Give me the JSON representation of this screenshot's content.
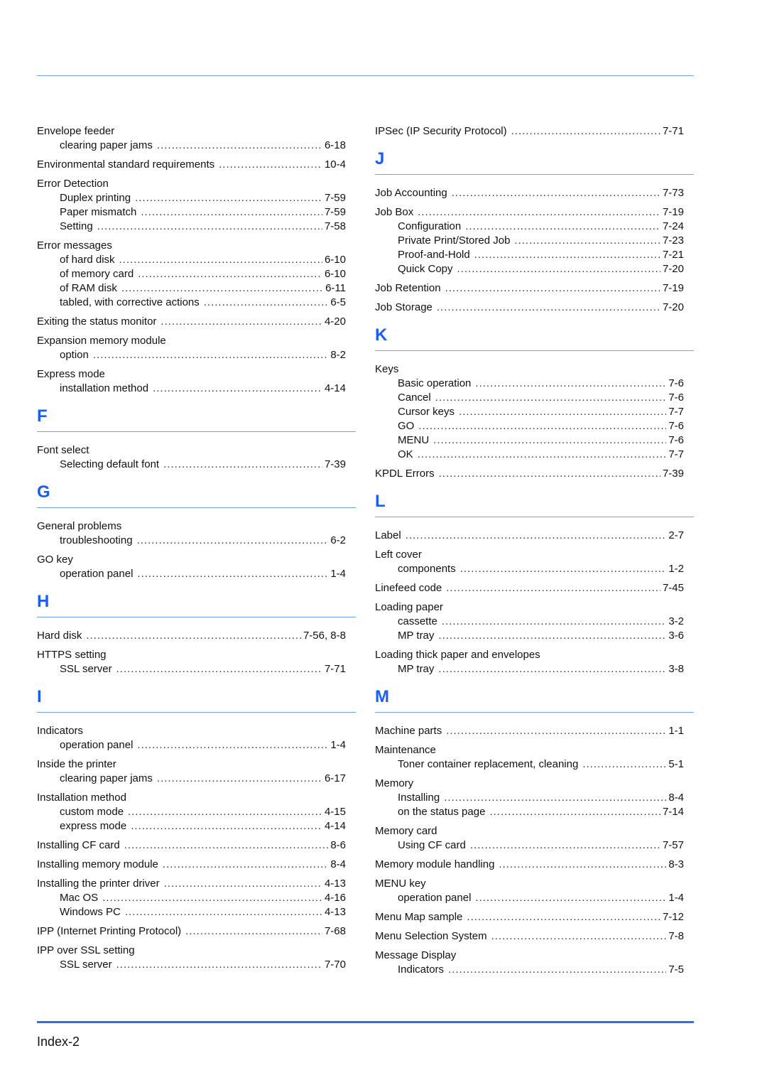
{
  "footer": {
    "page_label": "Index-2"
  },
  "left_column": [
    {
      "type": "entry",
      "term": "Envelope feeder",
      "subs": [
        {
          "term": "clearing paper jams",
          "page": "6-18"
        }
      ]
    },
    {
      "type": "entry",
      "term": "Environmental standard requirements",
      "page": "10-4"
    },
    {
      "type": "entry",
      "term": "Error Detection",
      "subs": [
        {
          "term": "Duplex printing",
          "page": "7-59"
        },
        {
          "term": "Paper mismatch",
          "page": "7-59"
        },
        {
          "term": "Setting",
          "page": "7-58"
        }
      ]
    },
    {
      "type": "entry",
      "term": "Error messages",
      "subs": [
        {
          "term": "of hard disk",
          "page": "6-10"
        },
        {
          "term": "of memory card",
          "page": "6-10"
        },
        {
          "term": "of RAM disk",
          "page": "6-11"
        },
        {
          "term": "tabled, with corrective actions",
          "page": "6-5"
        }
      ]
    },
    {
      "type": "entry",
      "term": "Exiting the status monitor",
      "page": "4-20"
    },
    {
      "type": "entry",
      "term": "Expansion memory module",
      "subs": [
        {
          "term": "option",
          "page": "8-2"
        }
      ]
    },
    {
      "type": "entry",
      "term": "Express mode",
      "subs": [
        {
          "term": "installation method",
          "page": "4-14"
        }
      ]
    },
    {
      "type": "letter",
      "letter": "F"
    },
    {
      "type": "entry",
      "term": "Font select",
      "subs": [
        {
          "term": "Selecting default font",
          "page": "7-39"
        }
      ]
    },
    {
      "type": "letter",
      "letter": "G"
    },
    {
      "type": "entry",
      "term": "General problems",
      "subs": [
        {
          "term": "troubleshooting",
          "page": "6-2"
        }
      ]
    },
    {
      "type": "entry",
      "term": "GO key",
      "subs": [
        {
          "term": "operation panel",
          "page": "1-4"
        }
      ]
    },
    {
      "type": "letter",
      "letter": "H"
    },
    {
      "type": "entry",
      "term": "Hard disk",
      "page": "7-56, 8-8"
    },
    {
      "type": "entry",
      "term": "HTTPS setting",
      "subs": [
        {
          "term": "SSL server",
          "page": "7-71"
        }
      ]
    },
    {
      "type": "letter",
      "letter": "I"
    },
    {
      "type": "entry",
      "term": "Indicators",
      "subs": [
        {
          "term": "operation panel",
          "page": "1-4"
        }
      ]
    },
    {
      "type": "entry",
      "term": "Inside the printer",
      "subs": [
        {
          "term": "clearing paper jams",
          "page": "6-17"
        }
      ]
    },
    {
      "type": "entry",
      "term": "Installation method",
      "subs": [
        {
          "term": "custom mode",
          "page": "4-15"
        },
        {
          "term": "express mode",
          "page": "4-14"
        }
      ]
    },
    {
      "type": "entry",
      "term": "Installing CF card",
      "page": "8-6"
    },
    {
      "type": "entry",
      "term": "Installing memory module",
      "page": "8-4"
    },
    {
      "type": "entry",
      "term": "Installing the printer driver",
      "page": "4-13",
      "subs": [
        {
          "term": "Mac OS",
          "page": "4-16"
        },
        {
          "term": "Windows PC",
          "page": "4-13"
        }
      ]
    },
    {
      "type": "entry",
      "term": "IPP (Internet Printing Protocol)",
      "page": "7-68"
    },
    {
      "type": "entry",
      "term": "IPP over SSL setting",
      "subs": [
        {
          "term": "SSL server",
          "page": "7-70"
        }
      ]
    }
  ],
  "right_column": [
    {
      "type": "entry",
      "term": "IPSec (IP Security Protocol)",
      "page": "7-71"
    },
    {
      "type": "letter",
      "letter": "J"
    },
    {
      "type": "entry",
      "term": "Job Accounting",
      "page": "7-73"
    },
    {
      "type": "entry",
      "term": "Job Box",
      "page": "7-19",
      "subs": [
        {
          "term": "Configuration",
          "page": "7-24"
        },
        {
          "term": "Private Print/Stored Job",
          "page": "7-23"
        },
        {
          "term": "Proof-and-Hold",
          "page": "7-21"
        },
        {
          "term": "Quick Copy",
          "page": "7-20"
        }
      ]
    },
    {
      "type": "entry",
      "term": "Job Retention",
      "page": "7-19"
    },
    {
      "type": "entry",
      "term": "Job Storage",
      "page": "7-20"
    },
    {
      "type": "letter",
      "letter": "K"
    },
    {
      "type": "entry",
      "term": "Keys",
      "subs": [
        {
          "term": "Basic operation",
          "page": "7-6"
        },
        {
          "term": "Cancel",
          "page": "7-6"
        },
        {
          "term": "Cursor keys",
          "page": "7-7"
        },
        {
          "term": "GO",
          "page": "7-6"
        },
        {
          "term": "MENU",
          "page": "7-6"
        },
        {
          "term": "OK",
          "page": "7-7"
        }
      ]
    },
    {
      "type": "entry",
      "term": "KPDL Errors",
      "page": "7-39"
    },
    {
      "type": "letter",
      "letter": "L"
    },
    {
      "type": "entry",
      "term": "Label",
      "page": "2-7"
    },
    {
      "type": "entry",
      "term": "Left cover",
      "subs": [
        {
          "term": "components",
          "page": "1-2"
        }
      ]
    },
    {
      "type": "entry",
      "term": "Linefeed code",
      "page": "7-45"
    },
    {
      "type": "entry",
      "term": "Loading paper",
      "subs": [
        {
          "term": "cassette",
          "page": "3-2"
        },
        {
          "term": "MP tray",
          "page": "3-6"
        }
      ]
    },
    {
      "type": "entry",
      "term": "Loading thick paper and envelopes",
      "subs": [
        {
          "term": "MP tray",
          "page": "3-8"
        }
      ]
    },
    {
      "type": "letter",
      "letter": "M"
    },
    {
      "type": "entry",
      "term": "Machine parts",
      "page": "1-1"
    },
    {
      "type": "entry",
      "term": "Maintenance",
      "subs": [
        {
          "term": "Toner container replacement, cleaning",
          "page": "5-1"
        }
      ]
    },
    {
      "type": "entry",
      "term": "Memory",
      "subs": [
        {
          "term": "Installing",
          "page": "8-4"
        },
        {
          "term": "on the status page",
          "page": "7-14"
        }
      ]
    },
    {
      "type": "entry",
      "term": "Memory card",
      "subs": [
        {
          "term": "Using CF card",
          "page": "7-57"
        }
      ]
    },
    {
      "type": "entry",
      "term": "Memory module handling",
      "page": "8-3"
    },
    {
      "type": "entry",
      "term": "MENU key",
      "subs": [
        {
          "term": "operation panel",
          "page": "1-4"
        }
      ]
    },
    {
      "type": "entry",
      "term": "Menu Map sample",
      "page": "7-12"
    },
    {
      "type": "entry",
      "term": "Menu Selection System",
      "page": "7-8"
    },
    {
      "type": "entry",
      "term": "Message Display",
      "subs": [
        {
          "term": "Indicators",
          "page": "7-5"
        }
      ]
    }
  ]
}
